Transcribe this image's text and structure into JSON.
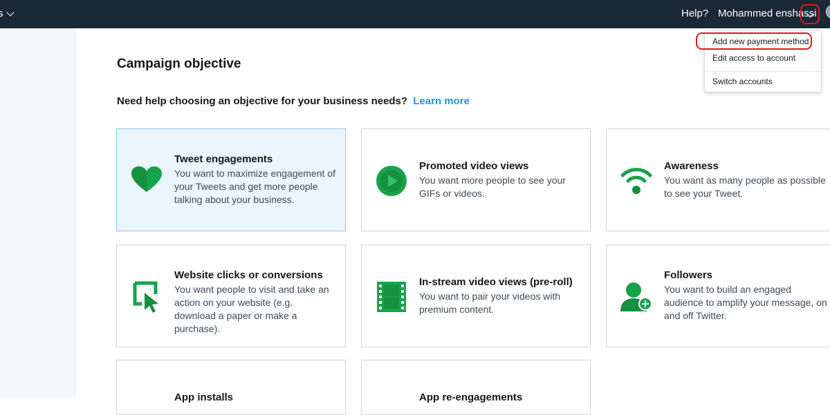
{
  "topbar": {
    "left_partial": "s",
    "help": "Help?",
    "user_name": "Mohammed enshassi"
  },
  "page": {
    "title": "Campaign objective",
    "help_text": "Need help choosing an objective for your business needs?",
    "learn_more": "Learn more"
  },
  "cards": [
    {
      "title": "Tweet engagements",
      "desc": "You want to maximize engagement of your Tweets and get more people talking about your business.",
      "icon": "heart-icon",
      "selected": true
    },
    {
      "title": "Promoted video views",
      "desc": "You want more people to see your GIFs or videos.",
      "icon": "play-icon",
      "selected": false
    },
    {
      "title": "Awareness",
      "desc": "You want as many people as possible to see your Tweet.",
      "icon": "broadcast-icon",
      "selected": false
    },
    {
      "title": "Website clicks or conversions",
      "desc": "You want people to visit and take an action on your website (e.g. download a paper or make a purchase).",
      "icon": "cursor-click-icon",
      "selected": false
    },
    {
      "title": "In-stream video views (pre-roll)",
      "desc": "You want to pair your videos with premium content.",
      "icon": "film-icon",
      "selected": false
    },
    {
      "title": "Followers",
      "desc": "You want to build an engaged audience to amplify your message, on and off Twitter.",
      "icon": "add-follower-icon",
      "selected": false
    },
    {
      "title": "App installs",
      "desc": "",
      "icon": "",
      "selected": false
    },
    {
      "title": "App re-engagements",
      "desc": "",
      "icon": "",
      "selected": false
    }
  ],
  "menu": {
    "items": [
      "Add new payment method",
      "Edit access to account",
      "Switch accounts"
    ]
  },
  "colors": {
    "topbar": "#1b2836",
    "accent_green": "#17a34a",
    "link_blue": "#1b95e0",
    "highlight_red": "#e1161f"
  }
}
